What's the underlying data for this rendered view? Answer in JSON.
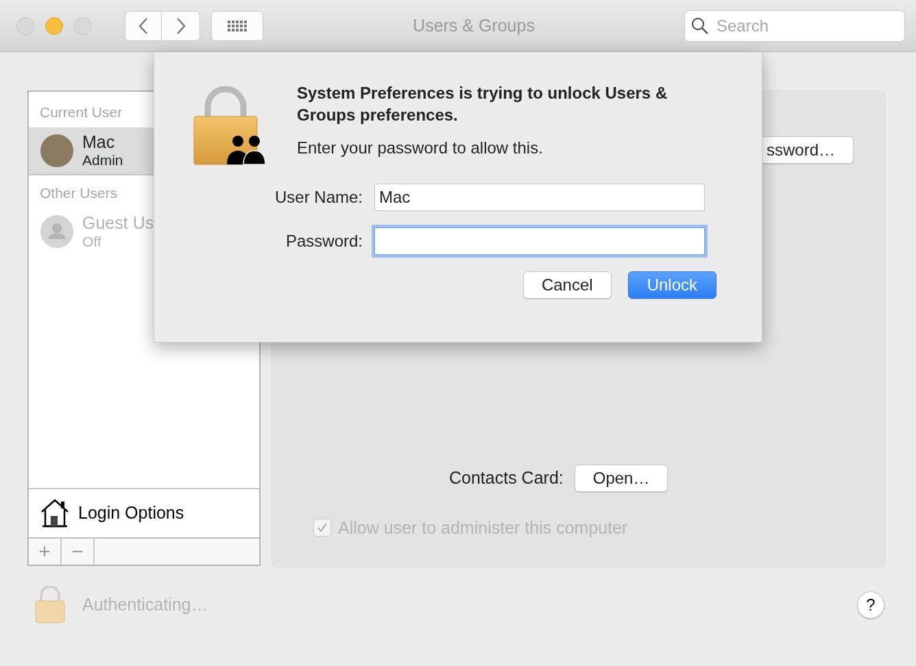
{
  "window": {
    "title": "Users & Groups"
  },
  "toolbar": {
    "search": {
      "placeholder": "Search"
    }
  },
  "sidebar": {
    "sections": [
      {
        "heading": "Current User",
        "users": [
          {
            "name": "Mac",
            "role": "Admin",
            "kind": "photo",
            "selected": true,
            "disabled": false
          }
        ]
      },
      {
        "heading": "Other Users",
        "users": [
          {
            "name": "Guest Us",
            "role": "Off",
            "kind": "guest",
            "selected": false,
            "disabled": true
          }
        ]
      }
    ],
    "login_options": "Login Options",
    "add_button": "+",
    "remove_button": "−"
  },
  "main": {
    "partial_button": "ssword…",
    "contacts_label": "Contacts Card:",
    "open_button": "Open…",
    "admin_checkbox": {
      "label": "Allow user to administer this computer",
      "checked": true,
      "disabled": true
    }
  },
  "footer": {
    "lock_status": "Authenticating…",
    "help": "?"
  },
  "dialog": {
    "title": "System Preferences is trying to unlock Users & Groups preferences.",
    "message": "Enter your password to allow this.",
    "fields": [
      {
        "label": "User Name:",
        "value": "Mac",
        "focused": false
      },
      {
        "label": "Password:",
        "focused": true
      }
    ],
    "buttons": [
      {
        "label": "Cancel",
        "default": false
      },
      {
        "label": "Unlock",
        "default": true
      }
    ]
  }
}
